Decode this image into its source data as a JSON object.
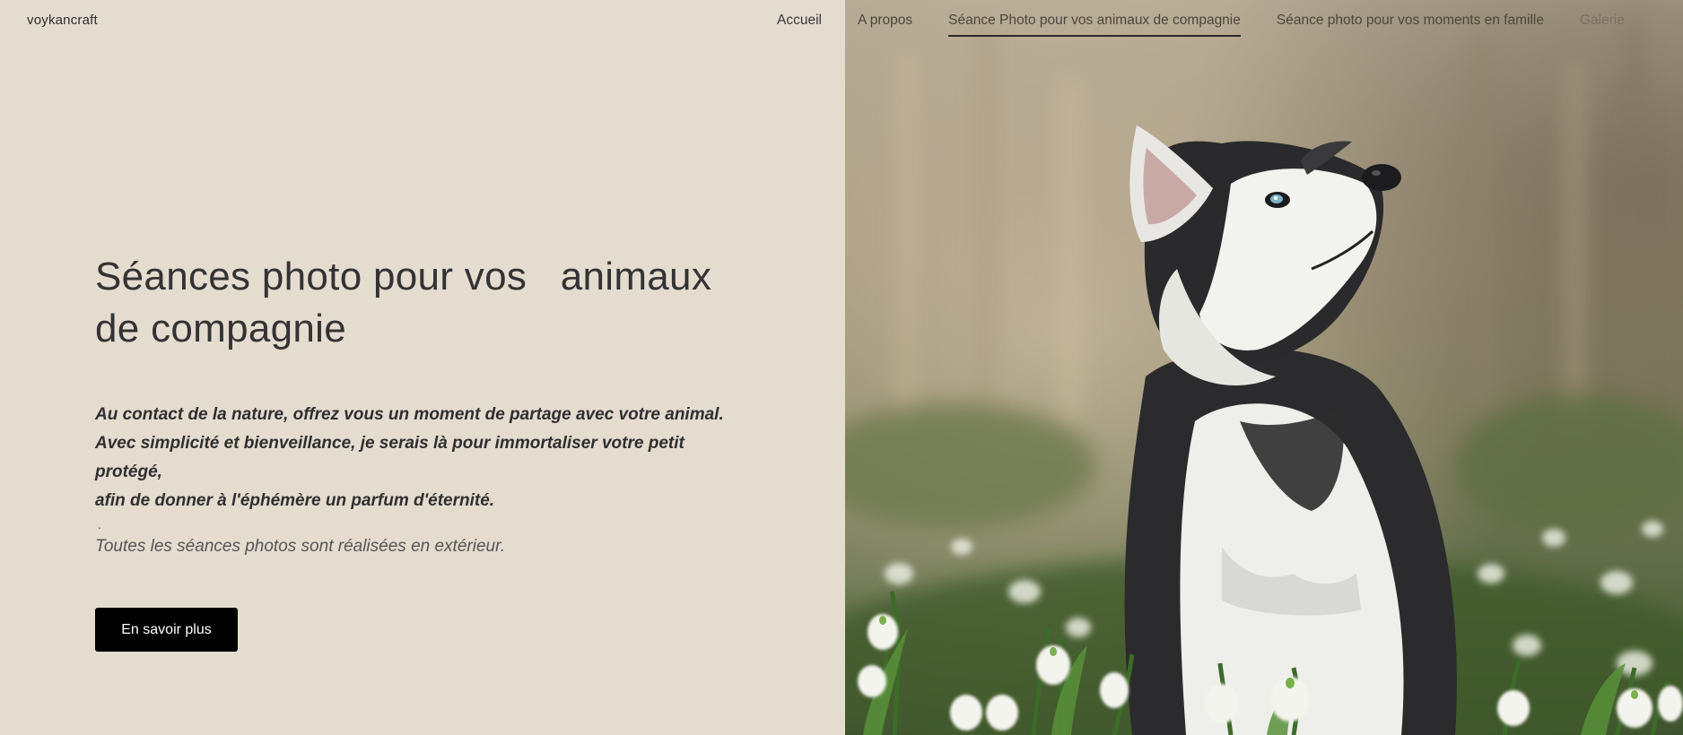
{
  "header": {
    "site_title": "voykancraft",
    "nav": [
      {
        "label": "Accueil"
      },
      {
        "label": "A propos"
      },
      {
        "label": "Séance Photo pour vos animaux de compagnie"
      },
      {
        "label": "Séance photo pour vos moments en famille"
      },
      {
        "label": "Galerie"
      }
    ],
    "active_index": 2
  },
  "hero": {
    "title": "Séances photo pour vos   animaux de compagnie",
    "lines": [
      "Au contact de la nature, offrez vous un moment de partage avec votre animal.",
      "Avec simplicité et bienveillance, je serais là pour immortaliser votre petit protégé,",
      "afin de donner à l'éphémère un parfum d'éternité."
    ],
    "dot": ".",
    "note": "Toutes les séances photos sont réalisées en extérieur.",
    "button_label": "En savoir plus"
  },
  "photo": {
    "subject": "husky puppy among snowdrop flowers"
  },
  "colors": {
    "background": "#e3dccf",
    "button": "#000000",
    "text": "#333333"
  }
}
